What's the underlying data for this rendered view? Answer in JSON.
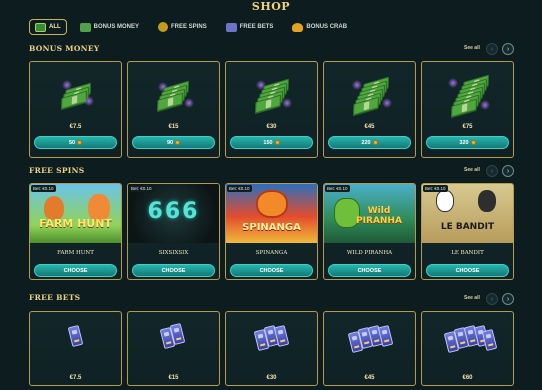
{
  "page": {
    "title": "SHOP"
  },
  "tabs": [
    {
      "label": "ALL",
      "icon": "money-stack-icon"
    },
    {
      "label": "BONUS MONEY",
      "icon": "cash-icon"
    },
    {
      "label": "FREE SPINS",
      "icon": "spin-coin-icon"
    },
    {
      "label": "FREE BETS",
      "icon": "bet-ticket-icon"
    },
    {
      "label": "BONUS CRAB",
      "icon": "crab-claw-icon"
    }
  ],
  "sections": {
    "bonus_money": {
      "title": "BONUS MONEY",
      "see_all": "See all",
      "items": [
        {
          "price": "€7.5",
          "cost": "50"
        },
        {
          "price": "€15",
          "cost": "90"
        },
        {
          "price": "€30",
          "cost": "150"
        },
        {
          "price": "€45",
          "cost": "220"
        },
        {
          "price": "€75",
          "cost": "320"
        }
      ]
    },
    "free_spins": {
      "title": "FREE SPINS",
      "see_all": "See all",
      "button_label": "CHOOSE",
      "items": [
        {
          "bet": "Bet: €0.10",
          "name": "FARM HUNT",
          "logo": "FARM HUNT"
        },
        {
          "bet": "Bet: €0.10",
          "name": "SIXSIXSIX",
          "logo": "666"
        },
        {
          "bet": "Bet: €0.10",
          "name": "SPINANGA",
          "logo": "SPINANGA"
        },
        {
          "bet": "Bet: €0.10",
          "name": "WILD PIRANHA",
          "logo": "Wild PIRANHA"
        },
        {
          "bet": "Bet: €0.10",
          "name": "LE BANDIT",
          "logo": "LE BANDIT"
        }
      ]
    },
    "free_bets": {
      "title": "FREE BETS",
      "see_all": "See all",
      "items": [
        {
          "price": "€7.5"
        },
        {
          "price": "€15"
        },
        {
          "price": "€30"
        },
        {
          "price": "€45"
        },
        {
          "price": "€60"
        }
      ]
    }
  },
  "colors": {
    "background": "#0d1c1f",
    "gold": "#f2d27a",
    "button": "#1f9e98"
  }
}
